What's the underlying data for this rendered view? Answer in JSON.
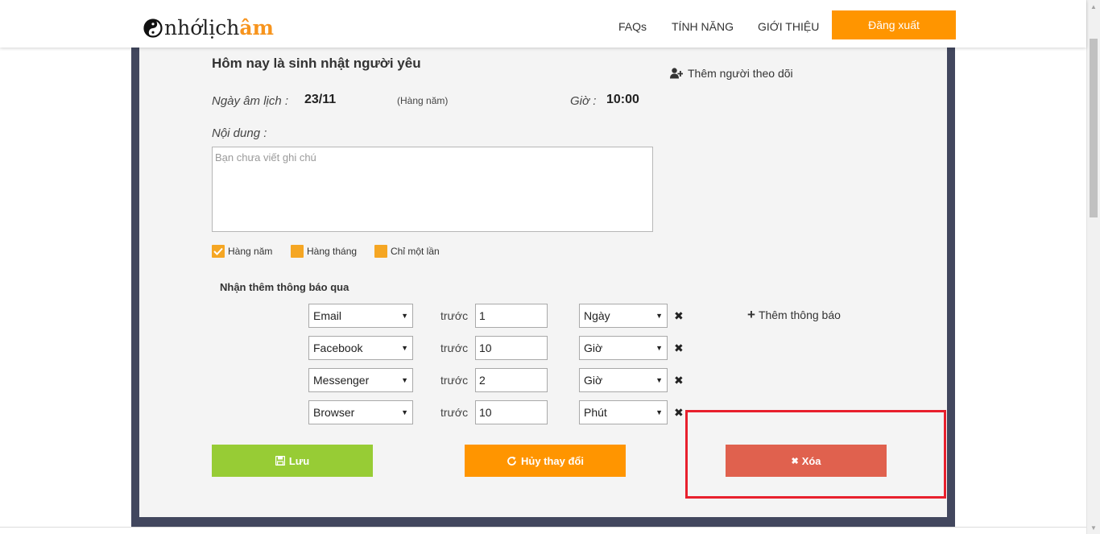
{
  "header": {
    "logo_part1": "nhớlịch",
    "logo_part2": "âm",
    "nav": [
      "FAQs",
      "TÍNH NĂNG",
      "GIỚI THIỆU"
    ],
    "logout_label": "Đăng xuất"
  },
  "event": {
    "title": "Hôm nay là sinh nhật người yêu",
    "follow_label": "Thêm người theo dõi",
    "lunar_date_label": "Ngày âm lịch :",
    "lunar_date_value": "23/11",
    "repeat_note": "(Hàng năm)",
    "time_label": "Giờ :",
    "time_value": "10:00",
    "content_label": "Nội dung :",
    "content_placeholder": "Bạn chưa viết ghi chú",
    "content_value": ""
  },
  "repeat_options": [
    {
      "label": "Hàng năm",
      "checked": true
    },
    {
      "label": "Hàng tháng",
      "checked": false
    },
    {
      "label": "Chỉ một lần",
      "checked": false
    }
  ],
  "notifications": {
    "title": "Nhận thêm thông báo qua",
    "before_label": "trước",
    "add_label": "Thêm thông báo",
    "rows": [
      {
        "channel": "Email",
        "amount": "1",
        "unit": "Ngày"
      },
      {
        "channel": "Facebook",
        "amount": "10",
        "unit": "Giờ"
      },
      {
        "channel": "Messenger",
        "amount": "2",
        "unit": "Giờ"
      },
      {
        "channel": "Browser",
        "amount": "10",
        "unit": "Phút"
      }
    ]
  },
  "actions": {
    "save_label": "Lưu",
    "cancel_label": "Hủy thay đổi",
    "delete_label": "Xóa"
  },
  "colors": {
    "brand_orange": "#ff9500",
    "save_green": "#97cc35",
    "delete_red": "#e0614e",
    "frame": "#42475e",
    "highlight": "#e8202d"
  }
}
